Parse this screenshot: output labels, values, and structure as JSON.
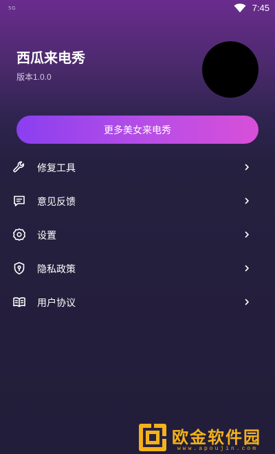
{
  "status_bar": {
    "network": "5G",
    "time": "7:45"
  },
  "header": {
    "title": "西瓜来电秀",
    "version": "版本1.0.0"
  },
  "promo": {
    "label": "更多美女来电秀"
  },
  "menu": {
    "items": [
      {
        "label": "修复工具",
        "icon": "wrench-icon"
      },
      {
        "label": "意见反馈",
        "icon": "feedback-icon"
      },
      {
        "label": "设置",
        "icon": "gear-icon"
      },
      {
        "label": "隐私政策",
        "icon": "privacy-shield-icon"
      },
      {
        "label": "用户协议",
        "icon": "agreement-book-icon"
      }
    ]
  },
  "watermark": {
    "text": "欧金软件园",
    "url": "www.apoujin.com"
  },
  "colors": {
    "accent_start": "#8a3ff0",
    "accent_end": "#d84fd8",
    "background": "#25203f",
    "watermark": "#f3b21b"
  }
}
